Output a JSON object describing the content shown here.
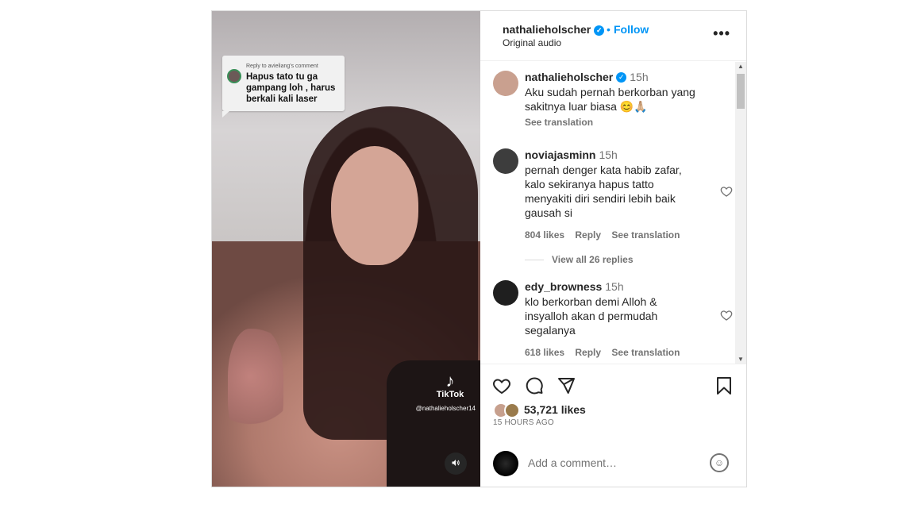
{
  "media": {
    "reply_header": "Reply to avieliang's comment",
    "reply_text": "Hapus tato tu ga gampang loh , harus berkali kali laser",
    "watermark_brand": "TikTok",
    "watermark_handle": "@nathalieholscher14",
    "mute_icon": "speaker-icon"
  },
  "header": {
    "username": "nathalieholscher",
    "separator": "•",
    "follow_label": "Follow",
    "audio_label": "Original audio",
    "more_icon": "more-horizontal-icon"
  },
  "comments": [
    {
      "username": "nathalieholscher",
      "time": "15h",
      "text": "Aku sudah pernah berkorban yang sakitnya luar biasa 😊🙏🏼",
      "see_translation": "See translation",
      "avatar_color": "#c9a08f"
    },
    {
      "username": "noviajasminn",
      "time": "15h",
      "text": "pernah denger kata habib zafar, kalo sekiranya hapus tatto menyakiti diri sendiri lebih baik gausah si",
      "likes": "804 likes",
      "reply": "Reply",
      "see_translation": "See translation",
      "avatar_color": "#3d3d3d"
    },
    {
      "username": "edy_browness",
      "time": "15h",
      "text": "klo berkorban demi Alloh & insyalloh akan d permudah segalanya",
      "likes": "618 likes",
      "reply": "Reply",
      "see_translation": "See translation",
      "avatar_color": "#1f1f1f"
    }
  ],
  "view_replies": "View all 26 replies",
  "actions": {
    "like_icon": "heart-icon",
    "comment_icon": "comment-icon",
    "share_icon": "send-icon",
    "save_icon": "bookmark-icon",
    "likes_count": "53,721 likes",
    "time_ago": "15 HOURS AGO"
  },
  "add_comment": {
    "placeholder": "Add a comment…",
    "emoji_icon": "emoji-icon"
  },
  "colors": {
    "link_blue": "#0095f6",
    "text_primary": "#262626",
    "text_secondary": "#737373",
    "border": "#dbdbdb"
  }
}
